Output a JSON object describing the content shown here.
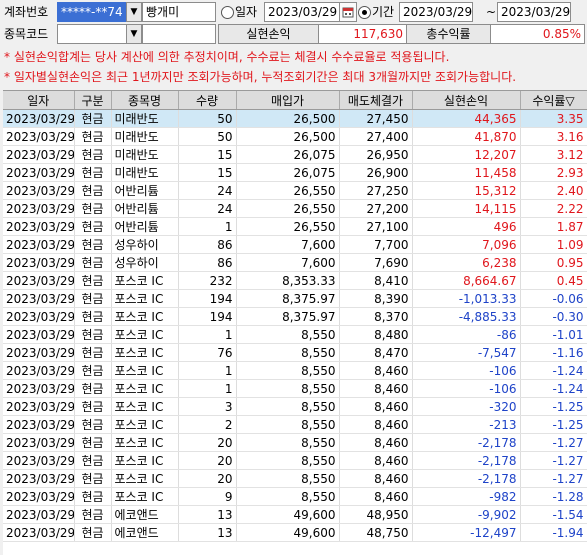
{
  "toolbar": {
    "account_label": "계좌번호",
    "account_number": "*****-**74",
    "account_holder": "빵개미",
    "single_date_label": "일자",
    "single_date": "2023/03/29",
    "range_label": "기간",
    "range_from": "2023/03/29",
    "range_sep": "~",
    "range_to": "2023/03/29",
    "stock_code_label": "종목코드",
    "stock_code": "",
    "stock_name": "",
    "realized_pnl_label": "실현손익",
    "realized_pnl_value": "117,630",
    "total_return_label": "총수익률",
    "total_return_value": "0.85%"
  },
  "notices": [
    "* 실현손익합계는 당사 계산에 의한 추정치이며, 수수료는 체결시 수수료율로 적용됩니다.",
    "* 일자별실현손익은 최근 1년까지만 조회가능하며, 누적조회기간은 최대 3개월까지만 조회가능합니다."
  ],
  "table": {
    "headers": [
      "일자",
      "구분",
      "종목명",
      "수량",
      "매입가",
      "매도체결가",
      "실현손익",
      "수익률▽"
    ],
    "rows": [
      [
        "2023/03/29",
        "현금",
        "미래반도",
        "50",
        "26,500",
        "27,450",
        "44,365",
        "3.35"
      ],
      [
        "2023/03/29",
        "현금",
        "미래반도",
        "50",
        "26,500",
        "27,400",
        "41,870",
        "3.16"
      ],
      [
        "2023/03/29",
        "현금",
        "미래반도",
        "15",
        "26,075",
        "26,950",
        "12,207",
        "3.12"
      ],
      [
        "2023/03/29",
        "현금",
        "미래반도",
        "15",
        "26,075",
        "26,900",
        "11,458",
        "2.93"
      ],
      [
        "2023/03/29",
        "현금",
        "어반리튬",
        "24",
        "26,550",
        "27,250",
        "15,312",
        "2.40"
      ],
      [
        "2023/03/29",
        "현금",
        "어반리튬",
        "24",
        "26,550",
        "27,200",
        "14,115",
        "2.22"
      ],
      [
        "2023/03/29",
        "현금",
        "어반리튬",
        "1",
        "26,550",
        "27,100",
        "496",
        "1.87"
      ],
      [
        "2023/03/29",
        "현금",
        "성우하이",
        "86",
        "7,600",
        "7,700",
        "7,096",
        "1.09"
      ],
      [
        "2023/03/29",
        "현금",
        "성우하이",
        "86",
        "7,600",
        "7,690",
        "6,238",
        "0.95"
      ],
      [
        "2023/03/29",
        "현금",
        "포스코 IC",
        "232",
        "8,353.33",
        "8,410",
        "8,664.67",
        "0.45"
      ],
      [
        "2023/03/29",
        "현금",
        "포스코 IC",
        "194",
        "8,375.97",
        "8,390",
        "-1,013.33",
        "-0.06"
      ],
      [
        "2023/03/29",
        "현금",
        "포스코 IC",
        "194",
        "8,375.97",
        "8,370",
        "-4,885.33",
        "-0.30"
      ],
      [
        "2023/03/29",
        "현금",
        "포스코 IC",
        "1",
        "8,550",
        "8,480",
        "-86",
        "-1.01"
      ],
      [
        "2023/03/29",
        "현금",
        "포스코 IC",
        "76",
        "8,550",
        "8,470",
        "-7,547",
        "-1.16"
      ],
      [
        "2023/03/29",
        "현금",
        "포스코 IC",
        "1",
        "8,550",
        "8,460",
        "-106",
        "-1.24"
      ],
      [
        "2023/03/29",
        "현금",
        "포스코 IC",
        "1",
        "8,550",
        "8,460",
        "-106",
        "-1.24"
      ],
      [
        "2023/03/29",
        "현금",
        "포스코 IC",
        "3",
        "8,550",
        "8,460",
        "-320",
        "-1.25"
      ],
      [
        "2023/03/29",
        "현금",
        "포스코 IC",
        "2",
        "8,550",
        "8,460",
        "-213",
        "-1.25"
      ],
      [
        "2023/03/29",
        "현금",
        "포스코 IC",
        "20",
        "8,550",
        "8,460",
        "-2,178",
        "-1.27"
      ],
      [
        "2023/03/29",
        "현금",
        "포스코 IC",
        "20",
        "8,550",
        "8,460",
        "-2,178",
        "-1.27"
      ],
      [
        "2023/03/29",
        "현금",
        "포스코 IC",
        "20",
        "8,550",
        "8,460",
        "-2,178",
        "-1.27"
      ],
      [
        "2023/03/29",
        "현금",
        "포스코 IC",
        "9",
        "8,550",
        "8,460",
        "-982",
        "-1.28"
      ],
      [
        "2023/03/29",
        "현금",
        "에코앤드",
        "13",
        "49,600",
        "48,950",
        "-9,902",
        "-1.54"
      ],
      [
        "2023/03/29",
        "현금",
        "에코앤드",
        "13",
        "49,600",
        "48,750",
        "-12,497",
        "-1.94"
      ]
    ]
  },
  "colors": {
    "profit": "#e0161c",
    "loss": "#1e43c8",
    "selected_row": "#d0e8f6",
    "header_bg": "#dcdcdc"
  },
  "icons": {
    "dropdown": "chevron-down-icon",
    "calendar": "calendar-icon"
  }
}
